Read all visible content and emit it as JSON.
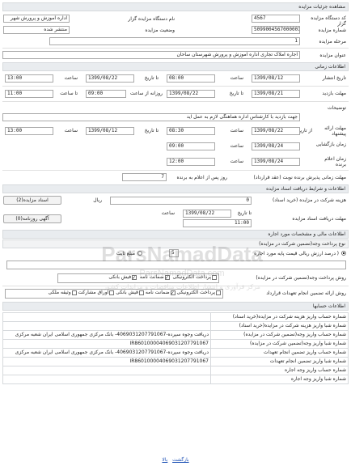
{
  "header": {
    "title": "مشاهده جزئیات مزایده"
  },
  "info": {
    "org_label": "نام دستگاه مزایده گزار",
    "org_value": "اداره آموزش و پرورش شهر",
    "code_label": "کد دستگاه مزایده گزار",
    "code_value": "4567",
    "status_label": "وضعیت مزایده",
    "status_value": "منتشر شده",
    "number_label": "شماره مزایده",
    "number_value": "5099004567000001",
    "stage_label": "مرحله مزایده",
    "stage_value": "1",
    "subject_label": "عنوان مزایده",
    "subject_value": "اجاره املاک تجاری اداره آموزش و پرورش شهرستان ساحان"
  },
  "timing": {
    "title": "اطلاعات زمانی",
    "label_to_date": "تا تاریخ",
    "label_hour": "ساعت",
    "label_to_hour": "تا ساعت",
    "publish_label": "تاریخ انتشار",
    "publish_date": "1399/08/12",
    "publish_time": "08:00",
    "publish_to_date": "1399/08/22",
    "publish_to_time": "13:00",
    "visit_label": "مهلت بازدید",
    "visit_date": "1399/08/21",
    "visit_time": "09:00",
    "visit_daily_label": "روزانه از ساعت",
    "visit_to_date": "1399/08/22",
    "visit_to_time": "11:00",
    "desc_label": "توضیحات",
    "desc_value": "جهت بازدید با کارشناس اداره هماهنگی لازم به عمل آید",
    "offer_label": "مهلت ارائه پیشنهاد",
    "offer_from_label": "از تاریخ",
    "offer_date": "1399/08/22",
    "offer_time": "08:30",
    "offer_to_date": "1399/08/12",
    "offer_to_time": "13:00",
    "opening_label": "زمان بازگشایی",
    "opening_date": "1399/08/24",
    "opening_time": "09:00",
    "winner_label": "زمان اعلام برنده",
    "winner_date": "1399/08/24",
    "winner_time": "12:00"
  },
  "contract": {
    "deadline_label": "مهلت زمانی پذیرش برنده نوبت (عقد قرارداد)",
    "deadline_value": "7",
    "deadline_suffix": "روز پس از اعلام به برنده"
  },
  "docs": {
    "title": "اطلاعات و شرایط دریافت اسناد مزایده",
    "fee_label": "هزینه شرکت در مزایده (خرید اسناد)",
    "fee_value": "0",
    "fee_unit": "ریال",
    "btn_docs": "اسناد مزایده(2)",
    "deadline_label": "مهلت دریافت اسناد مزایده",
    "deadline_to_date_label": "تا تاریخ",
    "deadline_date": "1399/08/22",
    "deadline_hour_label": "ساعت",
    "deadline_time": "11:00",
    "btn_ad": "آگهی روزنامه(0)"
  },
  "guarantee": {
    "title": "اطلاعات مالی و مشخصات مورد اجاره",
    "sub_title": "نوع پرداخت وجه(تضمین شرکت در مزایده)",
    "percent_value": "5",
    "percent_label": "درصد ارزش ریالی قیمت پایه مورد اجاره",
    "lump_label": "مبلغ ثابت",
    "method_label": "روش پرداخت وجه(تضمین شرکت در مزایده)",
    "method_opts": [
      "پرداخت الکترونیکی",
      "ضمانت نامه",
      "فیش بانکی"
    ],
    "method_checked": [
      false,
      true,
      true
    ],
    "contract_label": "روش ارائه تضمین انجام تعهدات قرارداد",
    "contract_opts": [
      "پرداخت الکترونیکی",
      "ضمانت نامه",
      "فیش بانکی",
      "اوراق مشارکت",
      "وثیقه ملکی"
    ],
    "contract_checked": [
      false,
      true,
      false,
      false,
      false
    ]
  },
  "accounts": {
    "title": "اطلاعات حسابها",
    "rows": [
      {
        "label": "شماره حساب واریز هزینه شرکت در مزایده(خرید اسناد)",
        "value": ""
      },
      {
        "label": "شماره شبا واریز هزینه شرکت در مزایده(خرید اسناد)",
        "value": ""
      },
      {
        "label": "شماره حساب واریز وجه(تضمین شرکت در مزایده)",
        "value": "دریافت وجوه سپرده-4069031207791067- بانک مرکزی جمهوری اسلامی ایران شعبه مرکزی"
      },
      {
        "label": "شماره شبا واریز وجه(تضمین شرکت در مزایده)",
        "value": "IR860100004069031207791067"
      },
      {
        "label": "شماره حساب واریز تضمین انجام تعهدات",
        "value": "دریافت وجوه سپرده-4069031207791067- بانک مرکزی جمهوری اسلامی ایران شعبه مرکزی"
      },
      {
        "label": "شماره شبا واریز تضمین انجام تعهدات",
        "value": "IR860100004069031207791067"
      },
      {
        "label": "شماره حساب واریز وجه اجاره",
        "value": ""
      },
      {
        "label": "شماره شبا واریز وجه اجاره",
        "value": ""
      }
    ]
  },
  "footer": {
    "back": "بازگشت",
    "top": "بالا"
  },
  "watermark": {
    "brand": "ParsNamadData",
    "line1": "ParsNamadData.com",
    "line2": "مرکز فرآوری و انتشار اطلاعات مناقصات و مزایدات کشور"
  }
}
